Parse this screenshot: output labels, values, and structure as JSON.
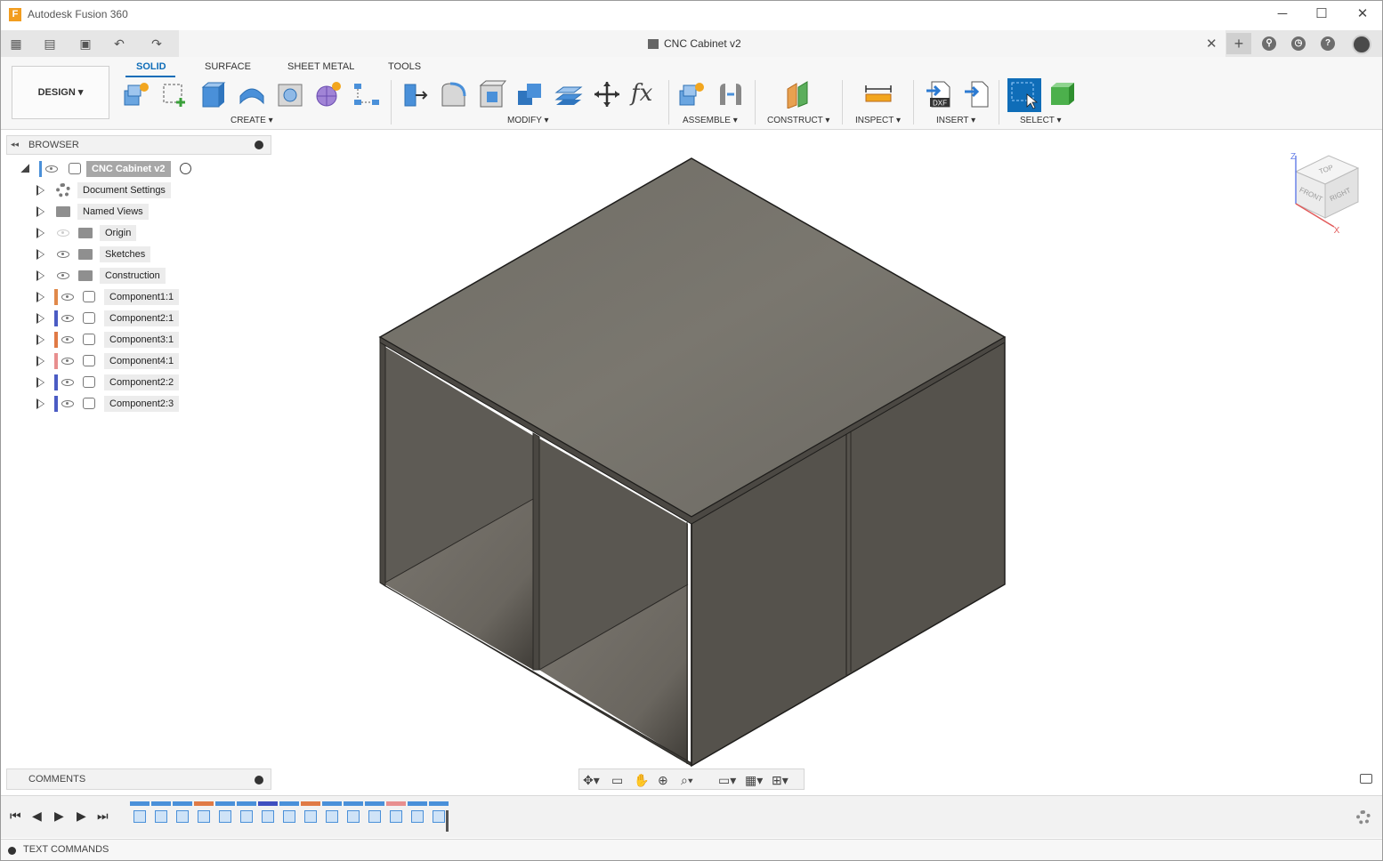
{
  "window": {
    "title": "Autodesk Fusion 360",
    "logo_letter": "F",
    "minimize": "─",
    "maximize": "☐",
    "close": "✕"
  },
  "appbar": {
    "grid_icon": "▦",
    "file_icon": "▤",
    "save_icon": "▣",
    "undo_icon": "↶",
    "redo_icon": "↷",
    "document_title": "CNC Cabinet v2",
    "close_tab": "✕",
    "new_tab": "+",
    "extensions_icon": "⚲",
    "jobs_icon": "◷",
    "help_icon": "?"
  },
  "toolbar": {
    "workspace": "DESIGN ▾",
    "tabs": [
      "SOLID",
      "SURFACE",
      "SHEET METAL",
      "TOOLS"
    ],
    "active_tab": "SOLID",
    "groups": {
      "create": "CREATE ▾",
      "modify": "MODIFY ▾",
      "assemble": "ASSEMBLE ▾",
      "construct": "CONSTRUCT ▾",
      "inspect": "INSPECT ▾",
      "insert": "INSERT ▾",
      "select": "SELECT ▾"
    },
    "modify_fx": "fx",
    "insert_dxf": "DXF"
  },
  "browser": {
    "title": "BROWSER",
    "collapse": "◂◂",
    "root": "CNC Cabinet v2",
    "items": [
      {
        "label": "Document Settings",
        "kind": "settings"
      },
      {
        "label": "Named Views",
        "kind": "folder"
      },
      {
        "label": "Origin",
        "kind": "folder",
        "visible": false
      },
      {
        "label": "Sketches",
        "kind": "folder",
        "visible": true
      },
      {
        "label": "Construction",
        "kind": "folder",
        "visible": true
      },
      {
        "label": "Component1:1",
        "kind": "component",
        "color": "#e0894a"
      },
      {
        "label": "Component2:1",
        "kind": "component",
        "color": "#4b5cc4"
      },
      {
        "label": "Component3:1",
        "kind": "component",
        "color": "#e07a45"
      },
      {
        "label": "Component4:1",
        "kind": "component",
        "color": "#e88f8f"
      },
      {
        "label": "Component2:2",
        "kind": "component",
        "color": "#4b5cc4"
      },
      {
        "label": "Component2:3",
        "kind": "component",
        "color": "#4b5cc4"
      }
    ]
  },
  "viewcube": {
    "top": "TOP",
    "front": "FRONT",
    "right": "RIGHT",
    "axis_z": "Z",
    "axis_x": "X"
  },
  "comments": {
    "title": "COMMENTS"
  },
  "navbar": {
    "orbit": "✥▾",
    "look_at": "▭",
    "pan": "✋",
    "zoom": "⊕",
    "fit": "⌕▾",
    "display": "▭▾",
    "grid": "▦▾",
    "viewports": "⊞▾"
  },
  "timeline": {
    "first": "⏮",
    "prev": "◀",
    "play": "▶",
    "next": "▶",
    "last": "⏭",
    "item_colors": [
      "#4a90d9",
      "#4a90d9",
      "#4a90d9",
      "#e07a45",
      "#4a90d9",
      "#4a90d9",
      "#3f4fc0",
      "#4a90d9",
      "#e07a45",
      "#4a90d9",
      "#4a90d9",
      "#4a90d9",
      "#e88f8f",
      "#4a90d9",
      "#4a90d9"
    ]
  },
  "textcommands": {
    "label": "TEXT COMMANDS"
  },
  "colors": {
    "accent": "#0f6db8",
    "model_top": "#75726b",
    "model_side": "#55524c",
    "model_inner": "#66635c"
  }
}
